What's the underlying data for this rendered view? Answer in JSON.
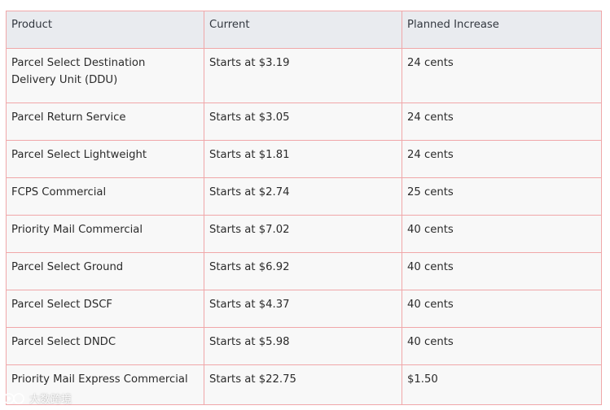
{
  "table": {
    "headers": [
      "Product",
      "Current",
      "Planned Increase"
    ],
    "rows": [
      {
        "product": "Parcel Select Destination Delivery Unit (DDU)",
        "current": "Starts at $3.19",
        "increase": "24 cents"
      },
      {
        "product": "Parcel Return Service",
        "current": "Starts at $3.05",
        "increase": "24 cents"
      },
      {
        "product": "Parcel Select Lightweight",
        "current": "Starts at $1.81",
        "increase": "24 cents"
      },
      {
        "product": "FCPS Commercial",
        "current": "Starts at $2.74",
        "increase": "25 cents"
      },
      {
        "product": "Priority Mail Commercial",
        "current": "Starts at $7.02",
        "increase": "40 cents"
      },
      {
        "product": "Parcel Select Ground",
        "current": "Starts at $6.92",
        "increase": "40 cents"
      },
      {
        "product": "Parcel Select DSCF",
        "current": "Starts at $4.37",
        "increase": "40 cents"
      },
      {
        "product": "Parcel Select DNDC",
        "current": "Starts at $5.98",
        "increase": "40 cents"
      },
      {
        "product": "Priority Mail Express Commercial",
        "current": "Starts at $22.75",
        "increase": "$1.50"
      }
    ]
  },
  "watermark": {
    "text": "大数跨境"
  },
  "colors": {
    "border": "#f0a7a9",
    "header_bg": "#e9ebef",
    "row_bg": "#f8f8f8"
  }
}
